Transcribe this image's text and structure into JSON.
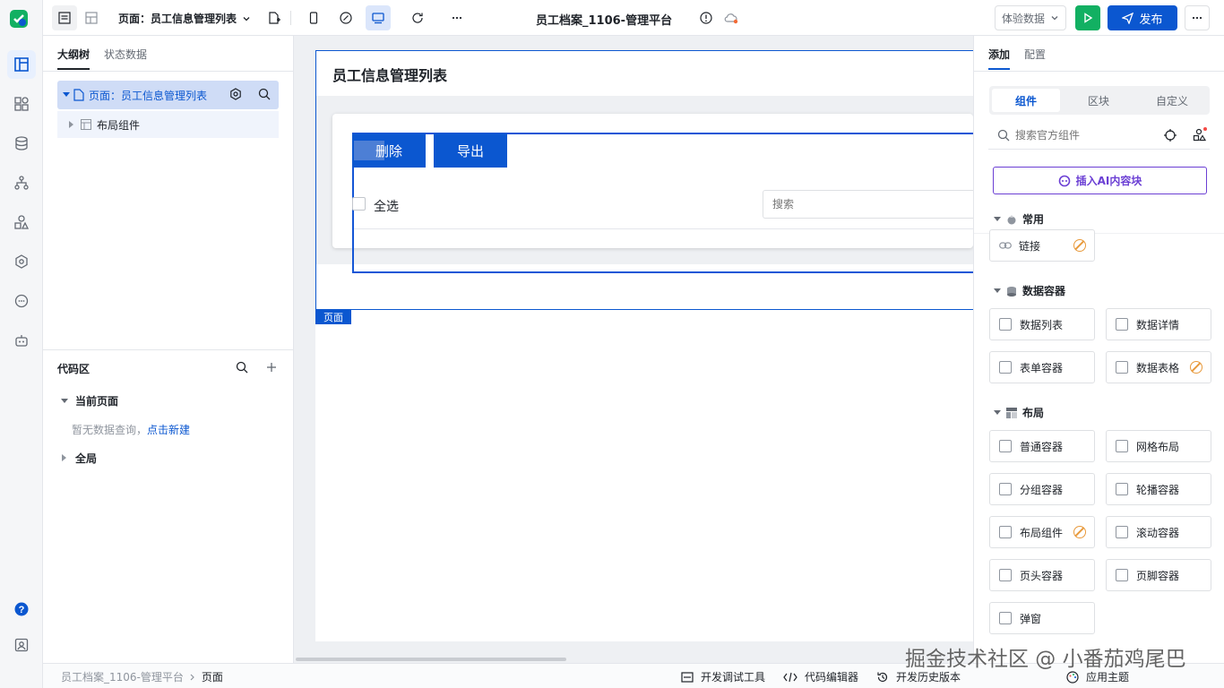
{
  "topbar": {
    "page_selector": "页面：员工信息管理列表",
    "app_title": "员工档案_1106-管理平台",
    "env_select": "体验数据",
    "publish": "发布"
  },
  "left": {
    "tabs": [
      "大纲树",
      "状态数据"
    ],
    "tree": {
      "page": "页面：员工信息管理列表",
      "child": "布局组件"
    },
    "code": {
      "title": "代码区",
      "current": "当前页面",
      "empty_text": "暂无数据查询，",
      "create_link": "点击新建",
      "global": "全局"
    }
  },
  "canvas": {
    "page_title": "员工信息管理列表",
    "delete_btn": "删除",
    "export_btn": "导出",
    "select_all": "全选",
    "search_placeholder": "搜索",
    "page_tag": "页面"
  },
  "right": {
    "tabs": [
      "添加",
      "配置"
    ],
    "segments": [
      "组件",
      "区块",
      "自定义"
    ],
    "search_placeholder": "搜索官方组件",
    "ai_button": "插入AI内容块",
    "sections": {
      "common": "常用",
      "data": "数据容器",
      "layout": "布局"
    },
    "common_items": [
      "链接"
    ],
    "data_items": [
      "数据列表",
      "数据详情",
      "表单容器",
      "数据表格"
    ],
    "layout_items": [
      "普通容器",
      "网格布局",
      "分组容器",
      "轮播容器",
      "布局组件",
      "滚动容器",
      "页头容器",
      "页脚容器",
      "弹窗"
    ]
  },
  "statusbar": {
    "breadcrumb": [
      "员工档案_1106-管理平台",
      "页面"
    ],
    "tools": [
      "开发调试工具",
      "代码编辑器",
      "开发历史版本",
      "应用主题"
    ]
  },
  "watermark": "掘金技术社区 @ 小番茄鸡尾巴",
  "colors": {
    "primary": "#0b57d0",
    "green": "#12b062",
    "ai_purple": "#6b3fd4"
  }
}
